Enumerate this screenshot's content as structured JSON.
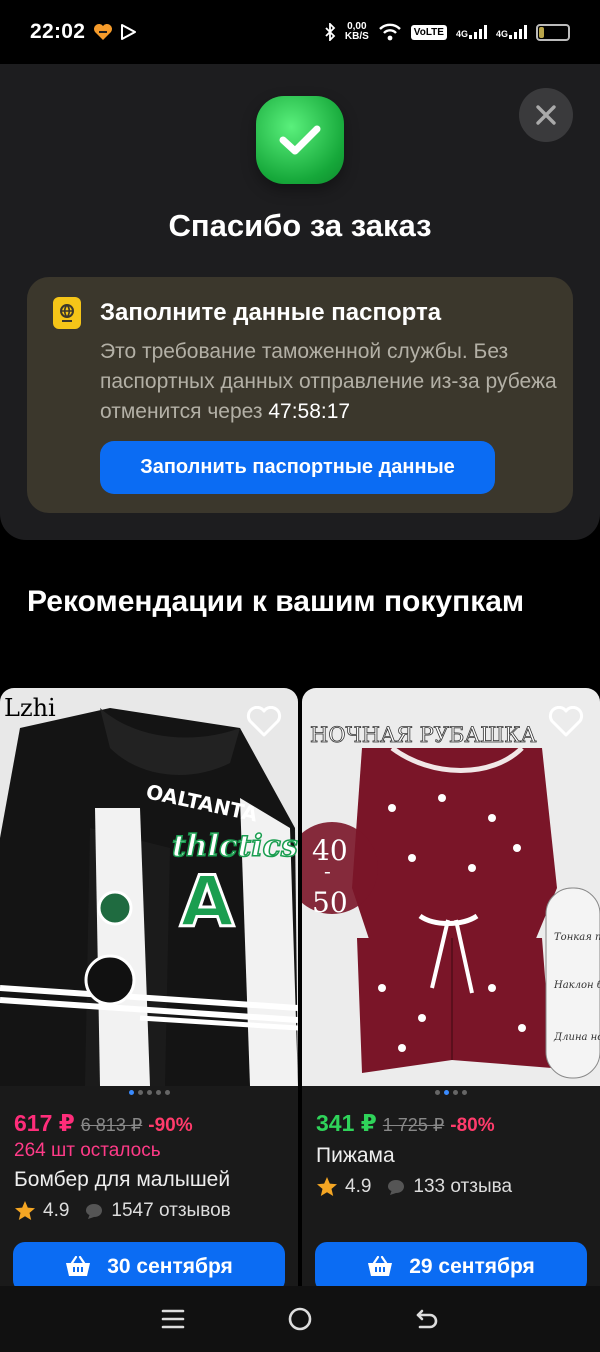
{
  "status_bar": {
    "time": "22:02",
    "speed_value": "0,00",
    "speed_unit": "KB/S",
    "volte": "VoLTE",
    "sim1_label": "4G",
    "sim2_label": "4G",
    "battery_level": "17",
    "battery_fraction": 0.17
  },
  "order_panel": {
    "close_icon": "close-icon",
    "check_icon": "check-icon",
    "title": "Спасибо за заказ"
  },
  "passport_card": {
    "icon": "passport-icon",
    "title": "Заполните данные паспорта",
    "description": "Это требование таможенной службы. Без паспортных данных отправление из-за рубежа отменится через",
    "timer": "47:58:17",
    "button_label": "Заполнить паспортные данные"
  },
  "recommendations": {
    "title": "Рекомендации к вашим покупкам",
    "products": [
      {
        "image_text_top": "Lzhi",
        "image_text_center": "thlctics",
        "image_text_name": "OALTANTA",
        "price": "617 ₽",
        "old_price": "6 813 ₽",
        "discount": "-90%",
        "stock": "264 шт осталось",
        "name": "Бомбер для малышей",
        "rating": "4.9",
        "reviews": "1547 отзывов",
        "delivery_label": "30 сентября"
      },
      {
        "image_text_top": "НОЧНАЯ РУБАШКА",
        "image_text_size": "40 - 50",
        "badge_1": "Тонкая талия",
        "badge_2": "Наклон бедер",
        "badge_3": "Длина ноги",
        "price": "341 ₽",
        "old_price": "1 725 ₽",
        "discount": "-80%",
        "name": "Пижама",
        "rating": "4.9",
        "reviews": "133 отзыва",
        "delivery_label": "29 сентября"
      }
    ]
  },
  "colors": {
    "accent_blue": "#0b6cf3",
    "price_pink": "#ff2d7a",
    "price_green": "#2fd35a",
    "star": "#f5a623"
  }
}
